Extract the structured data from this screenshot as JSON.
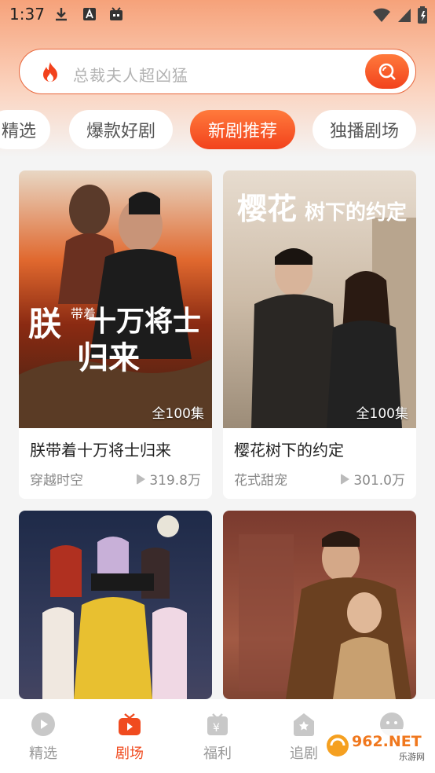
{
  "status_bar": {
    "time": "1:37"
  },
  "search": {
    "placeholder": "总裁夫人超凶猛"
  },
  "tabs": [
    {
      "label": "精选"
    },
    {
      "label": "爆款好剧"
    },
    {
      "label": "新剧推荐",
      "active": true
    },
    {
      "label": "独播剧场"
    }
  ],
  "dramas": [
    {
      "title": "朕带着十万将士归来",
      "episodes": "全100集",
      "tag": "穿越时空",
      "views": "319.8万",
      "poster_text": [
        "朕",
        "带着",
        "十万将士",
        "归来"
      ]
    },
    {
      "title": "樱花树下的约定",
      "episodes": "全100集",
      "tag": "花式甜宠",
      "views": "301.0万",
      "poster_text": [
        "樱花",
        "树下的约定"
      ]
    },
    {
      "title": "",
      "episodes": "",
      "tag": "",
      "views": ""
    },
    {
      "title": "",
      "episodes": "",
      "tag": "",
      "views": ""
    }
  ],
  "bottom_nav": [
    {
      "label": "精选",
      "icon": "play-circle-icon"
    },
    {
      "label": "剧场",
      "icon": "tv-icon",
      "active": true
    },
    {
      "label": "福利",
      "icon": "gift-icon"
    },
    {
      "label": "追剧",
      "icon": "star-house-icon"
    },
    {
      "label": "",
      "icon": "face-icon"
    }
  ],
  "watermark": {
    "brand": "962.NET",
    "sub": "乐游网"
  },
  "colors": {
    "accent": "#f2421c",
    "accent_light": "#ff7a3c",
    "page_bg": "#f4f4f4"
  }
}
